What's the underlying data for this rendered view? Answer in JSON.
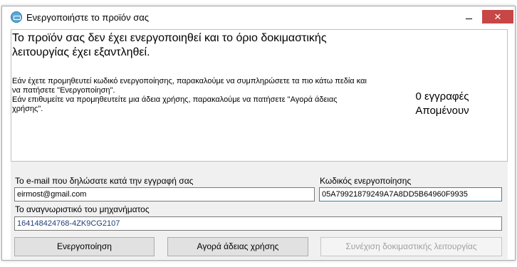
{
  "window": {
    "title": "Ενεργοποιήστε το προϊόν σας",
    "close_glyph": "✕"
  },
  "message": {
    "headline": "Το προϊόν σας δεν έχει ενεργοποιηθεί και το όριο δοκιμαστικής λειτουργίας έχει εξαντληθεί.",
    "instruction_1": "Εάν έχετε προμηθευτεί κωδικό ενεργοποίησης, παρακαλούμε να συμπληρώσετε τα πιο κάτω πεδία και να πατήσετε \"Ενεργοποίηση\".",
    "instruction_2": "Εάν επιθυμείτε να προμηθευτείτε μια άδεια χρήσης, παρακαλούμε να πατήσετε \"Αγορά άδειας χρήσης\"."
  },
  "records": {
    "count_text": "0 εγγραφές",
    "remaining_text": "Απομένουν"
  },
  "form": {
    "email_label": "Το e-mail που δηλώσατε κατά την εγγραφή σας",
    "email_value": "eirmost@gmail.com",
    "code_label": "Κωδικός ενεργοποίησης",
    "code_value": "05A79921879249A7A8DD5B64960F9935",
    "machine_label": "Το αναγνωριστικό του μηχανήματος",
    "machine_value": "164148424768-4ZK9CG2107"
  },
  "buttons": {
    "activate": "Ενεργοποίηση",
    "buy_license": "Αγορά άδειας χρήσης",
    "continue_trial": "Συνέχιση δοκιμαστικής λειτουργίας"
  },
  "colors": {
    "close_button": "#c74646",
    "panel_background": "#f0f0f0",
    "machine_id_text": "#1f3f7a"
  },
  "icons": {
    "app_icon": "app-icon",
    "minimize": "minimize-icon",
    "close": "close-icon"
  }
}
